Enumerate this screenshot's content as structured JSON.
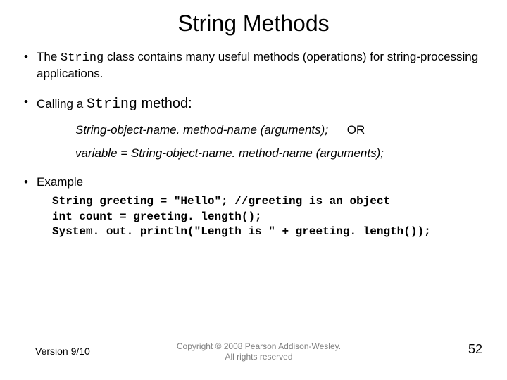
{
  "title": "String Methods",
  "bullets": {
    "b1_pre": "The ",
    "b1_code": "String",
    "b1_post": " class contains many useful methods (operations) for string-processing applications.",
    "b2_pre": "Calling a ",
    "b2_code": "String",
    "b2_post": " method:",
    "syntax1": "String-object-name. method-name (arguments);",
    "or": "OR",
    "syntax2": "variable = String-object-name. method-name (arguments);",
    "b3": "Example",
    "code_l1": "String greeting = \"Hello\";  //greeting is an object",
    "code_l2": "int count = greeting. length();",
    "code_l3": "System. out. println(\"Length is \" + greeting. length());"
  },
  "footer": {
    "version": "Version 9/10",
    "copyright_l1": "Copyright © 2008 Pearson Addison-Wesley.",
    "copyright_l2": "All rights reserved",
    "page": "52"
  }
}
